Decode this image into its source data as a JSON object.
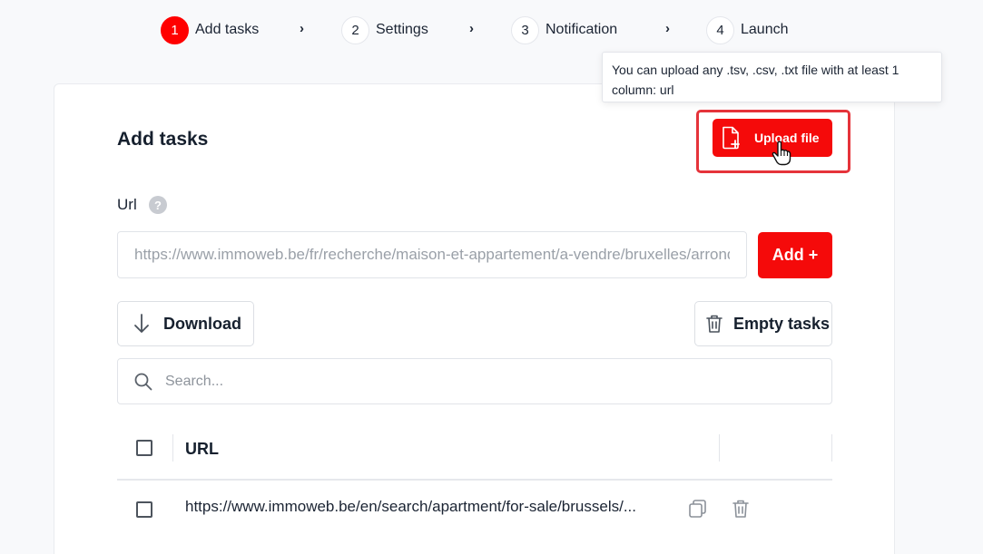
{
  "stepper": {
    "steps": [
      {
        "num": "1",
        "label": "Add tasks",
        "active": true
      },
      {
        "num": "2",
        "label": "Settings",
        "active": false
      },
      {
        "num": "3",
        "label": "Notification",
        "active": false
      },
      {
        "num": "4",
        "label": "Launch",
        "active": false
      }
    ],
    "separator": "›"
  },
  "tooltip": {
    "text": "You can upload any .tsv, .csv, .txt file with at least 1 column: url"
  },
  "card": {
    "title": "Add tasks",
    "upload_label": "Upload file",
    "url_label": "Url",
    "help_glyph": "?",
    "url_input_placeholder": "https://www.immoweb.be/fr/recherche/maison-et-appartement/a-vendre/bruxelles/arrondissement",
    "add_label": "Add +",
    "download_label": "Download",
    "empty_label": "Empty tasks",
    "search_placeholder": "Search..."
  },
  "table": {
    "columns": [
      "URL"
    ],
    "rows": [
      {
        "url": "https://www.immoweb.be/en/search/apartment/for-sale/brussels/..."
      }
    ]
  },
  "colors": {
    "accent": "#f50a0a",
    "highlight_border": "#e5333a",
    "text": "#1b2433",
    "background": "#f8f9fb"
  },
  "icons": {
    "upload": "file-plus-icon",
    "download": "arrow-down-icon",
    "empty": "trash-icon",
    "search": "search-icon",
    "copy": "copy-icon",
    "delete": "trash-icon",
    "help": "question-icon",
    "cursor": "hand-pointer-icon"
  }
}
